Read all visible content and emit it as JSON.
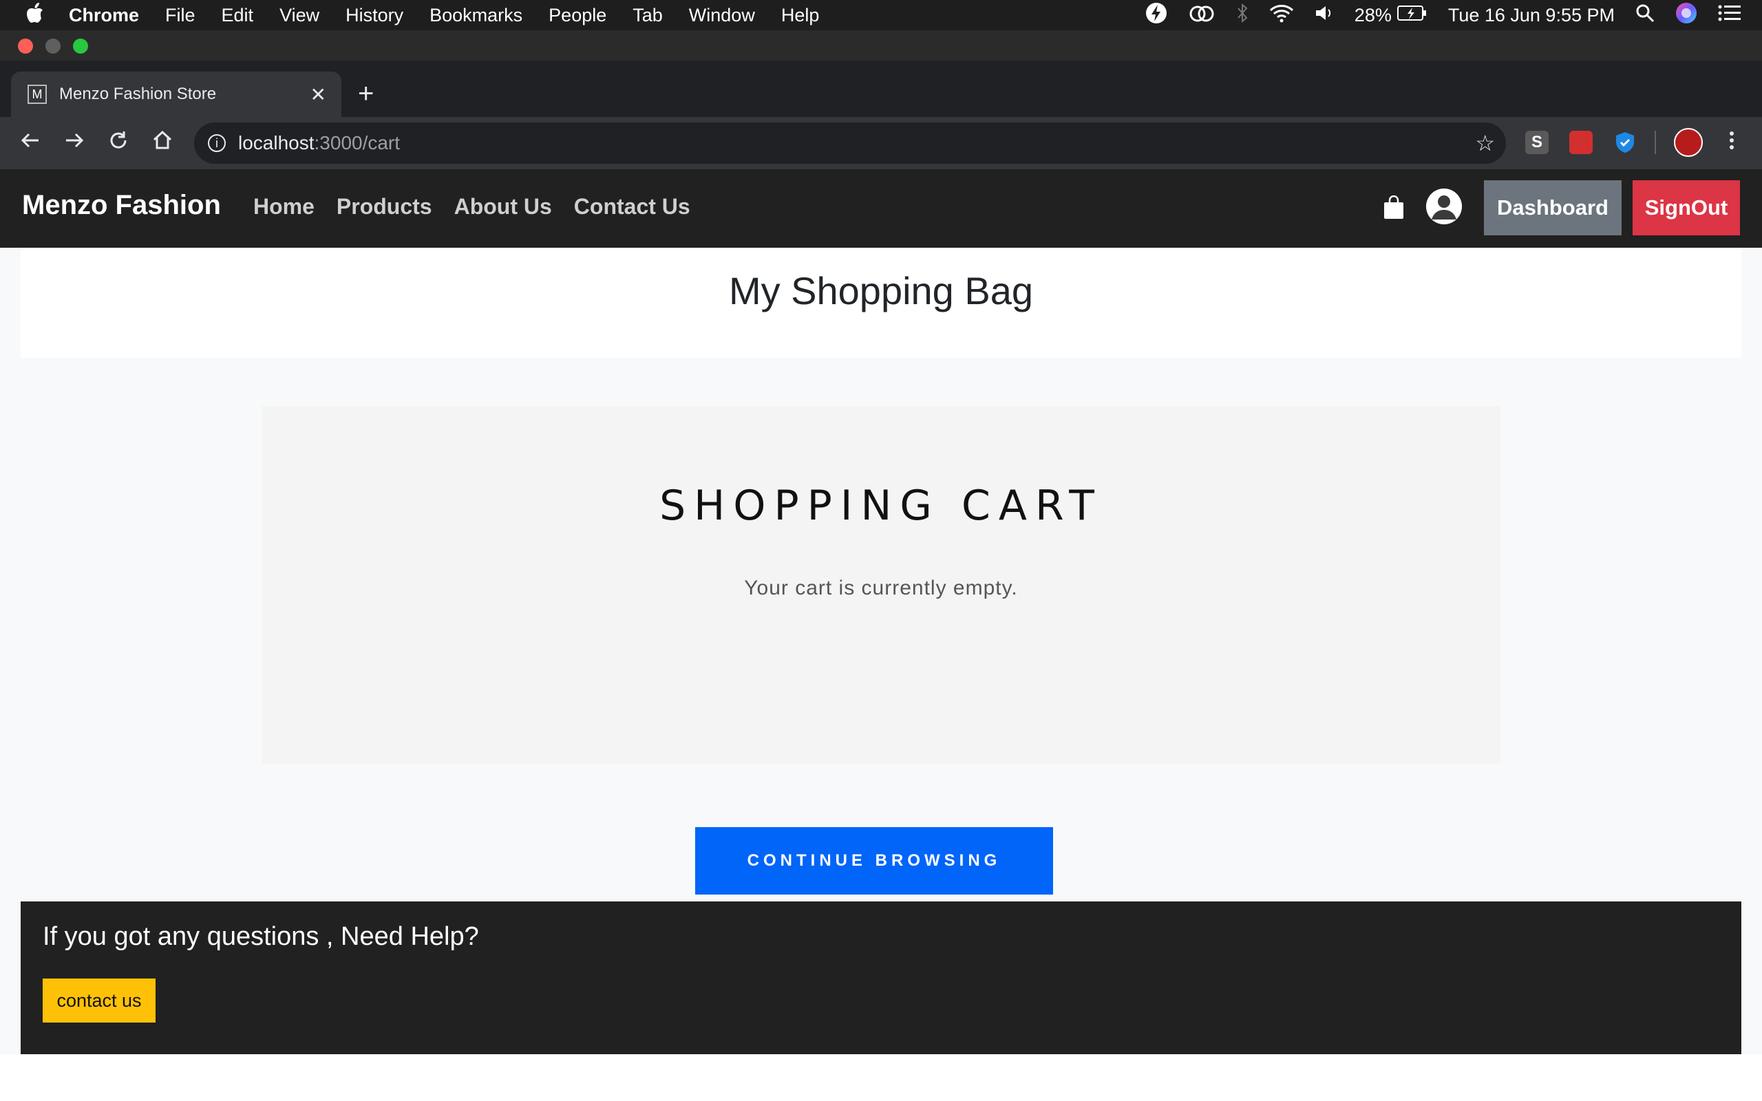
{
  "menubar": {
    "app": "Chrome",
    "items": [
      "File",
      "Edit",
      "View",
      "History",
      "Bookmarks",
      "People",
      "Tab",
      "Window",
      "Help"
    ],
    "battery": "28%",
    "datetime": "Tue 16 Jun  9:55 PM"
  },
  "browser": {
    "tab_title": "Menzo Fashion Store",
    "tab_favicon": "M",
    "url_host": "localhost",
    "url_path": ":3000/cart"
  },
  "site": {
    "brand": "Menzo Fashion",
    "nav": [
      "Home",
      "Products",
      "About Us",
      "Contact Us"
    ],
    "dashboard_label": "Dashboard",
    "signout_label": "SignOut"
  },
  "main": {
    "page_title": "My Shopping Bag",
    "cart_title": "SHOPPING CART",
    "cart_empty_text": "Your cart is currently empty.",
    "continue_label": "CONTINUE BROWSING"
  },
  "footer": {
    "question": "If you got any questions , Need Help?",
    "contact_label": "contact us"
  },
  "colors": {
    "continue_button": "#0165fa",
    "signout_button": "#dc3545",
    "dashboard_button": "#6c757d",
    "contact_button": "#ffc107"
  }
}
